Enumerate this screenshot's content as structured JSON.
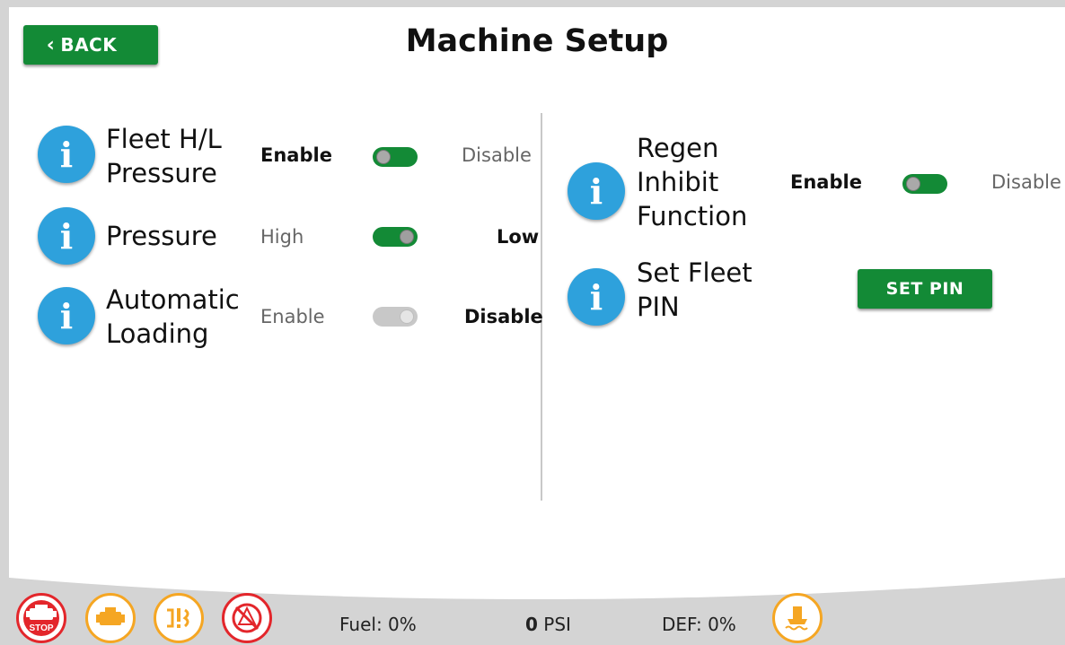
{
  "header": {
    "back_label": "BACK",
    "title": "Machine Setup"
  },
  "left_settings": [
    {
      "label_lines": [
        "Fleet H/L",
        "Pressure"
      ],
      "option_left": "Enable",
      "option_right": "Disable",
      "selected": "Enable",
      "enabled": true
    },
    {
      "label_lines": [
        "Pressure"
      ],
      "option_left": "High",
      "option_right": "Low",
      "selected": "Low",
      "enabled": true
    },
    {
      "label_lines": [
        "Automatic",
        "Loading"
      ],
      "option_left": "Enable",
      "option_right": "Disable",
      "selected": "Disable",
      "enabled": false
    }
  ],
  "right_settings": {
    "regen": {
      "label_lines": [
        "Regen",
        "Inhibit",
        "Function"
      ],
      "option_left": "Enable",
      "option_right": "Disable",
      "selected": "Enable"
    },
    "fleet_pin": {
      "label_lines": [
        "Set Fleet",
        "PIN"
      ],
      "button_label": "SET PIN"
    }
  },
  "status_bar": {
    "fuel": "Fuel: 0%",
    "pressure_value": "0",
    "pressure_unit": "PSI",
    "def": "DEF: 0%",
    "stop_text": "STOP",
    "icons": [
      "engine-stop-icon",
      "engine-warning-icon",
      "exhaust-filter-icon",
      "regen-inhibit-icon",
      "coolant-level-icon"
    ]
  },
  "colors": {
    "accent_green": "#138a36",
    "info_blue": "#2ea1dc",
    "stop_red": "#e3262b",
    "warning_orange": "#f5a623"
  },
  "info_symbol": "i"
}
